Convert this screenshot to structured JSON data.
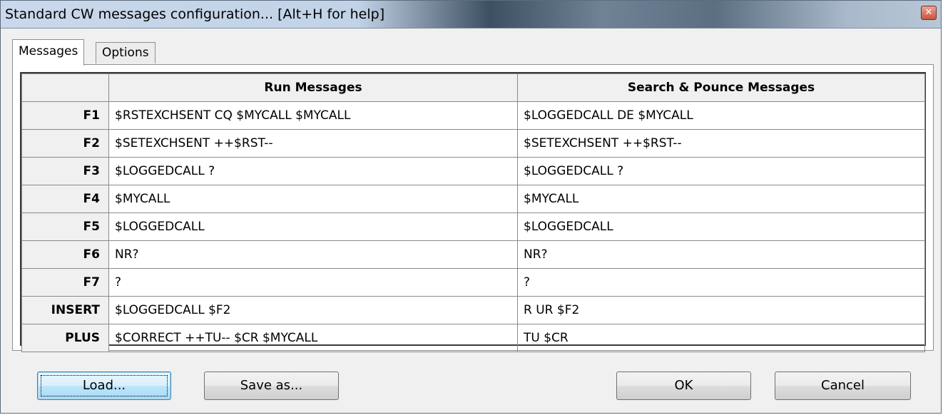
{
  "window": {
    "title": "Standard CW messages configuration... [Alt+H for help]",
    "close_glyph": "✕"
  },
  "tabs": [
    {
      "label": "Messages",
      "active": true
    },
    {
      "label": "Options",
      "active": false
    }
  ],
  "table": {
    "columns": [
      "Run Messages",
      "Search & Pounce Messages"
    ],
    "rows": [
      {
        "key": "F1",
        "run": "$RSTEXCHSENT CQ $MYCALL $MYCALL",
        "sp": "$LOGGEDCALL DE $MYCALL"
      },
      {
        "key": "F2",
        "run": "$SETEXCHSENT ++$RST--",
        "sp": "$SETEXCHSENT ++$RST--"
      },
      {
        "key": "F3",
        "run": "$LOGGEDCALL ?",
        "sp": "$LOGGEDCALL ?"
      },
      {
        "key": "F4",
        "run": "$MYCALL",
        "sp": "$MYCALL"
      },
      {
        "key": "F5",
        "run": "$LOGGEDCALL",
        "sp": "$LOGGEDCALL"
      },
      {
        "key": "F6",
        "run": "NR?",
        "sp": "NR?"
      },
      {
        "key": "F7",
        "run": "?",
        "sp": "?"
      },
      {
        "key": "INSERT",
        "run": "$LOGGEDCALL $F2",
        "sp": "R UR $F2"
      },
      {
        "key": "PLUS",
        "run": "$CORRECT ++TU-- $CR $MYCALL",
        "sp": "TU $CR"
      }
    ]
  },
  "buttons": {
    "load": "Load...",
    "save_as": "Save as...",
    "ok": "OK",
    "cancel": "Cancel"
  }
}
